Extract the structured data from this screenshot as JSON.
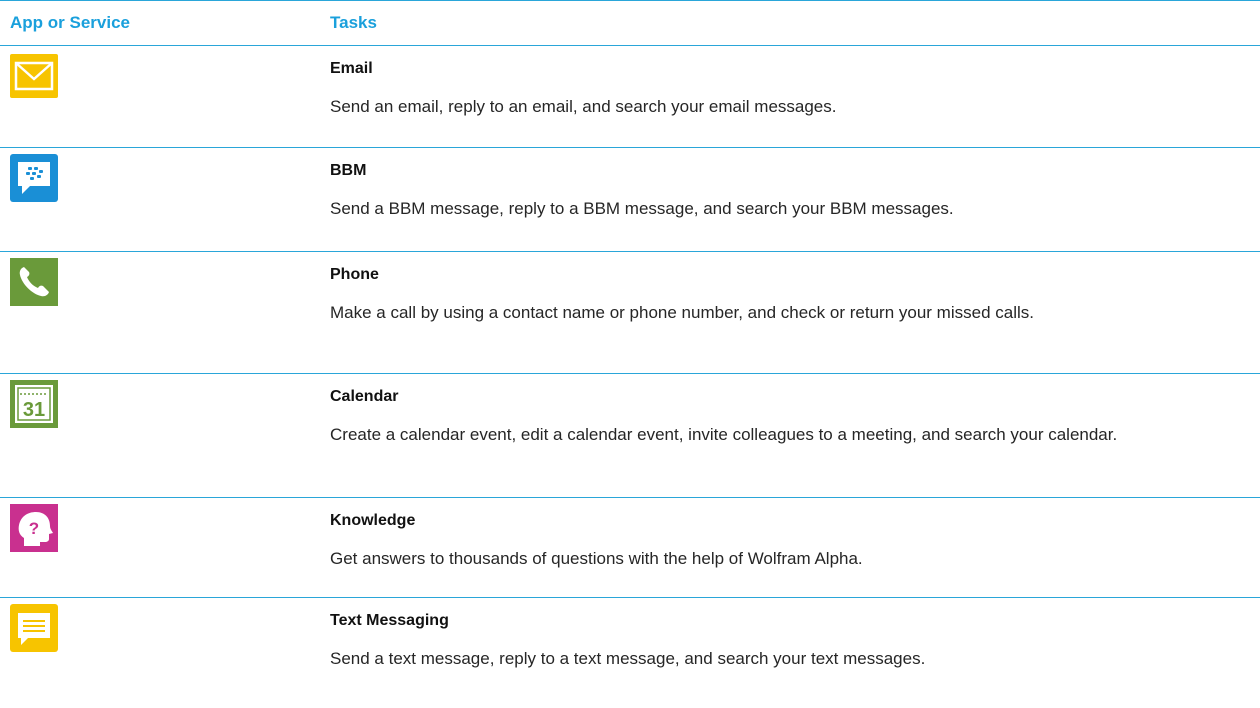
{
  "header": {
    "col1": "App or Service",
    "col2": "Tasks"
  },
  "rows": [
    {
      "icon": "email-icon",
      "title": "Email",
      "description": "Send an email, reply to an email, and search your email messages."
    },
    {
      "icon": "bbm-icon",
      "title": "BBM",
      "description": "Send a BBM message, reply to a BBM message, and search your BBM messages."
    },
    {
      "icon": "phone-icon",
      "title": "Phone",
      "description": "Make a call by using a contact name or phone number, and check or return your missed calls."
    },
    {
      "icon": "calendar-icon",
      "title": "Calendar",
      "calendar_number": "31",
      "description": "Create a calendar event, edit a calendar event, invite colleagues to a meeting, and search your calendar."
    },
    {
      "icon": "knowledge-icon",
      "title": "Knowledge",
      "description": "Get answers to thousands of questions with the help of Wolfram Alpha."
    },
    {
      "icon": "text-messaging-icon",
      "title": "Text Messaging",
      "description": "Send a text message, reply to a text message, and search your text messages."
    }
  ],
  "colors": {
    "accent": "#1aa0dc",
    "email": "#f7c400",
    "bbm": "#1a8fd6",
    "phone": "#6a9a3a",
    "calendar": "#6a9a3a",
    "knowledge": "#c9308f",
    "text_messaging": "#f7c400"
  }
}
